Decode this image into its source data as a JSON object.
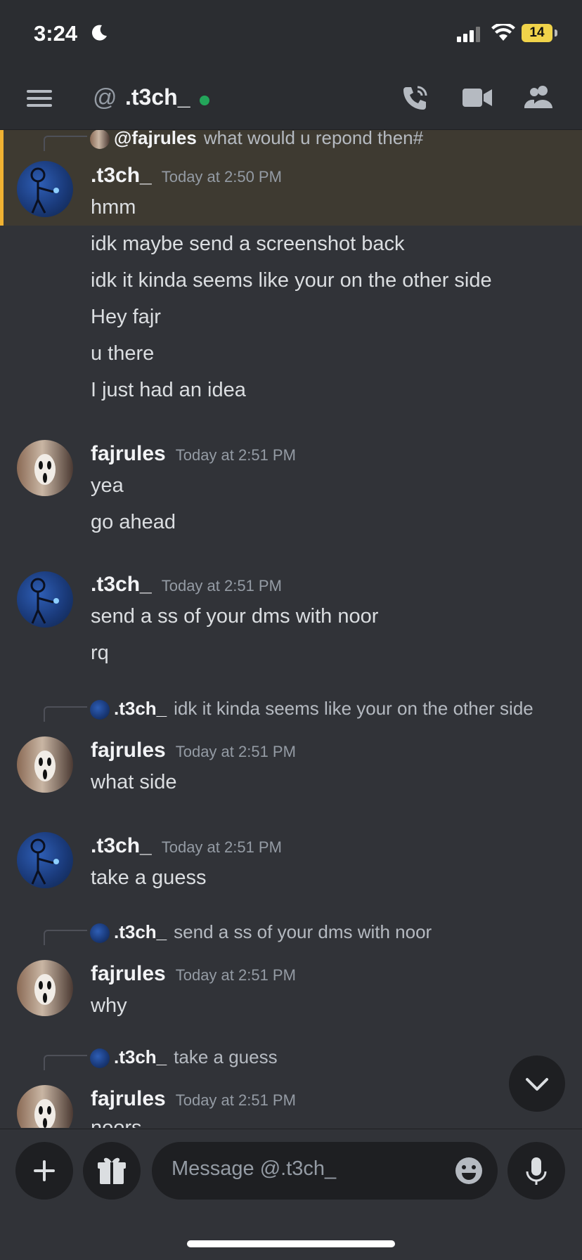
{
  "status_bar": {
    "time": "3:24",
    "battery": "14"
  },
  "header": {
    "at_symbol": "@",
    "title": ".t3ch_"
  },
  "messages": [
    {
      "reply_to_name": "@fajrules",
      "reply_to_text": "what would u repond then#",
      "author": ".t3ch_",
      "time": "Today at 2:50 PM",
      "lines": [
        "hmm",
        "idk maybe send a screenshot back",
        "idk it kinda seems like your on the other side",
        "Hey fajr",
        "u there",
        "I just had an idea"
      ]
    },
    {
      "author": "fajrules",
      "time": "Today at 2:51 PM",
      "lines": [
        "yea",
        "go ahead"
      ]
    },
    {
      "author": ".t3ch_",
      "time": "Today at 2:51 PM",
      "lines": [
        "send a ss of your dms with noor",
        "rq"
      ]
    },
    {
      "reply_to_name": ".t3ch_",
      "reply_to_text": "idk it kinda seems like your on the other side",
      "author": "fajrules",
      "time": "Today at 2:51 PM",
      "lines": [
        "what side"
      ]
    },
    {
      "author": ".t3ch_",
      "time": "Today at 2:51 PM",
      "lines": [
        "take a guess"
      ]
    },
    {
      "reply_to_name": ".t3ch_",
      "reply_to_text": "send a ss of your dms with noor",
      "author": "fajrules",
      "time": "Today at 2:51 PM",
      "lines": [
        "why"
      ]
    },
    {
      "reply_to_name": ".t3ch_",
      "reply_to_text": "take a guess",
      "author": "fajrules",
      "time": "Today at 2:51 PM",
      "lines": [
        "noors"
      ]
    }
  ],
  "composer": {
    "placeholder": "Message @.t3ch_"
  },
  "colors": {
    "background": "#313338",
    "header": "#2b2d31",
    "mention_highlight": "#f0b232",
    "online": "#23a55a"
  }
}
